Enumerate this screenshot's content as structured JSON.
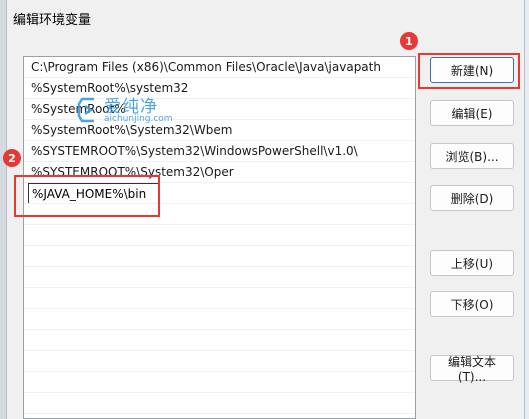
{
  "window": {
    "title": "编辑环境变量"
  },
  "path_list": {
    "rows": [
      "C:\\Program Files (x86)\\Common Files\\Oracle\\Java\\javapath",
      "%SystemRoot%\\system32",
      "%SystemRoot%",
      "%SystemRoot%\\System32\\Wbem",
      "%SYSTEMROOT%\\System32\\WindowsPowerShell\\v1.0\\",
      "%SYSTEMROOT%\\System32\\Oper"
    ],
    "editing_value": "%JAVA_HOME%\\bin"
  },
  "buttons": {
    "new": "新建(N)",
    "edit": "编辑(E)",
    "browse": "浏览(B)...",
    "delete": "删除(D)",
    "move_up": "上移(U)",
    "move_down": "下移(O)",
    "edit_text": "编辑文本(T)..."
  },
  "annotations": {
    "marker_1": "1",
    "marker_2": "2"
  },
  "watermark": {
    "brand": "爱纯净",
    "url": "aichunjing.com"
  },
  "colors": {
    "highlight": "#e53935",
    "watermark": "#3b9be0"
  }
}
